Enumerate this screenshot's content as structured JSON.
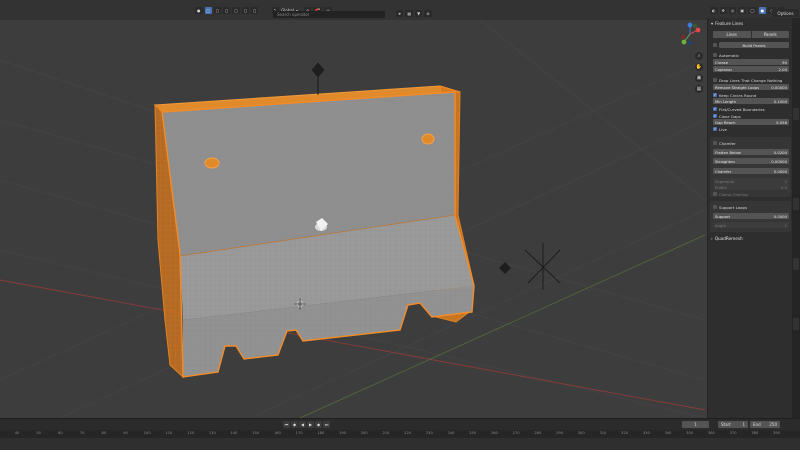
{
  "header": {
    "transform_orientation": "Global",
    "search_placeholder": "Search operator",
    "options_label": "Options",
    "accent_color": "#4772b3"
  },
  "panel": {
    "feature_lines": {
      "title": "Feature Lines",
      "tab_lines": "Lines",
      "tab_panels": "Panels",
      "build_panels": "Build Panels",
      "automatic": "Automatic",
      "crease_label": "Crease",
      "crease_value": "90",
      "coplanar_label": "Coplanar",
      "coplanar_value": "2.00",
      "drop_lines": "Drop Lines That Change Nothing",
      "remove_straight_label": "Remove Straight Loops",
      "remove_straight_value": "0.00000",
      "keep_circles": "Keep Circles Round",
      "min_length_label": "Min Length",
      "min_length_value": "0.1000",
      "flat_curved": "Flat/Curved Boundaries",
      "close_gaps": "Close Gaps",
      "gap_reach_label": "Gap Reach",
      "gap_reach_value": "0.056",
      "live": "Live"
    },
    "chamfer": {
      "title": "Chamfer",
      "flatten_below_label": "Flatten Below",
      "flatten_below_value": "0.0200",
      "straighten_label": "Straighten",
      "straighten_value": "0.00000",
      "chamfer_label": "Chamfer",
      "chamfer_value": "0.0000",
      "segments_label": "Segments",
      "segments_value": "2",
      "profile_label": "Profile",
      "profile_value": "0.5",
      "clamp_overlap": "Clamp Overlap"
    },
    "support_loops": {
      "title": "Support Loops",
      "support_label": "Support",
      "support_value": "0.0000",
      "angle_label": "Angle",
      "angle_value": "1"
    },
    "quadremesh": "QuadRemesh"
  },
  "timeline": {
    "current_frame": "1",
    "start_label": "Start",
    "start_value": "1",
    "end_label": "End",
    "end_value": "250",
    "ticks": [
      "40",
      "50",
      "60",
      "70",
      "80",
      "90",
      "100",
      "110",
      "120",
      "130",
      "140",
      "150",
      "160",
      "170",
      "180",
      "190",
      "200",
      "210",
      "220",
      "230",
      "240",
      "250",
      "260",
      "270",
      "280",
      "290",
      "300",
      "310",
      "320",
      "330",
      "340",
      "350",
      "360",
      "370",
      "380",
      "390"
    ]
  }
}
